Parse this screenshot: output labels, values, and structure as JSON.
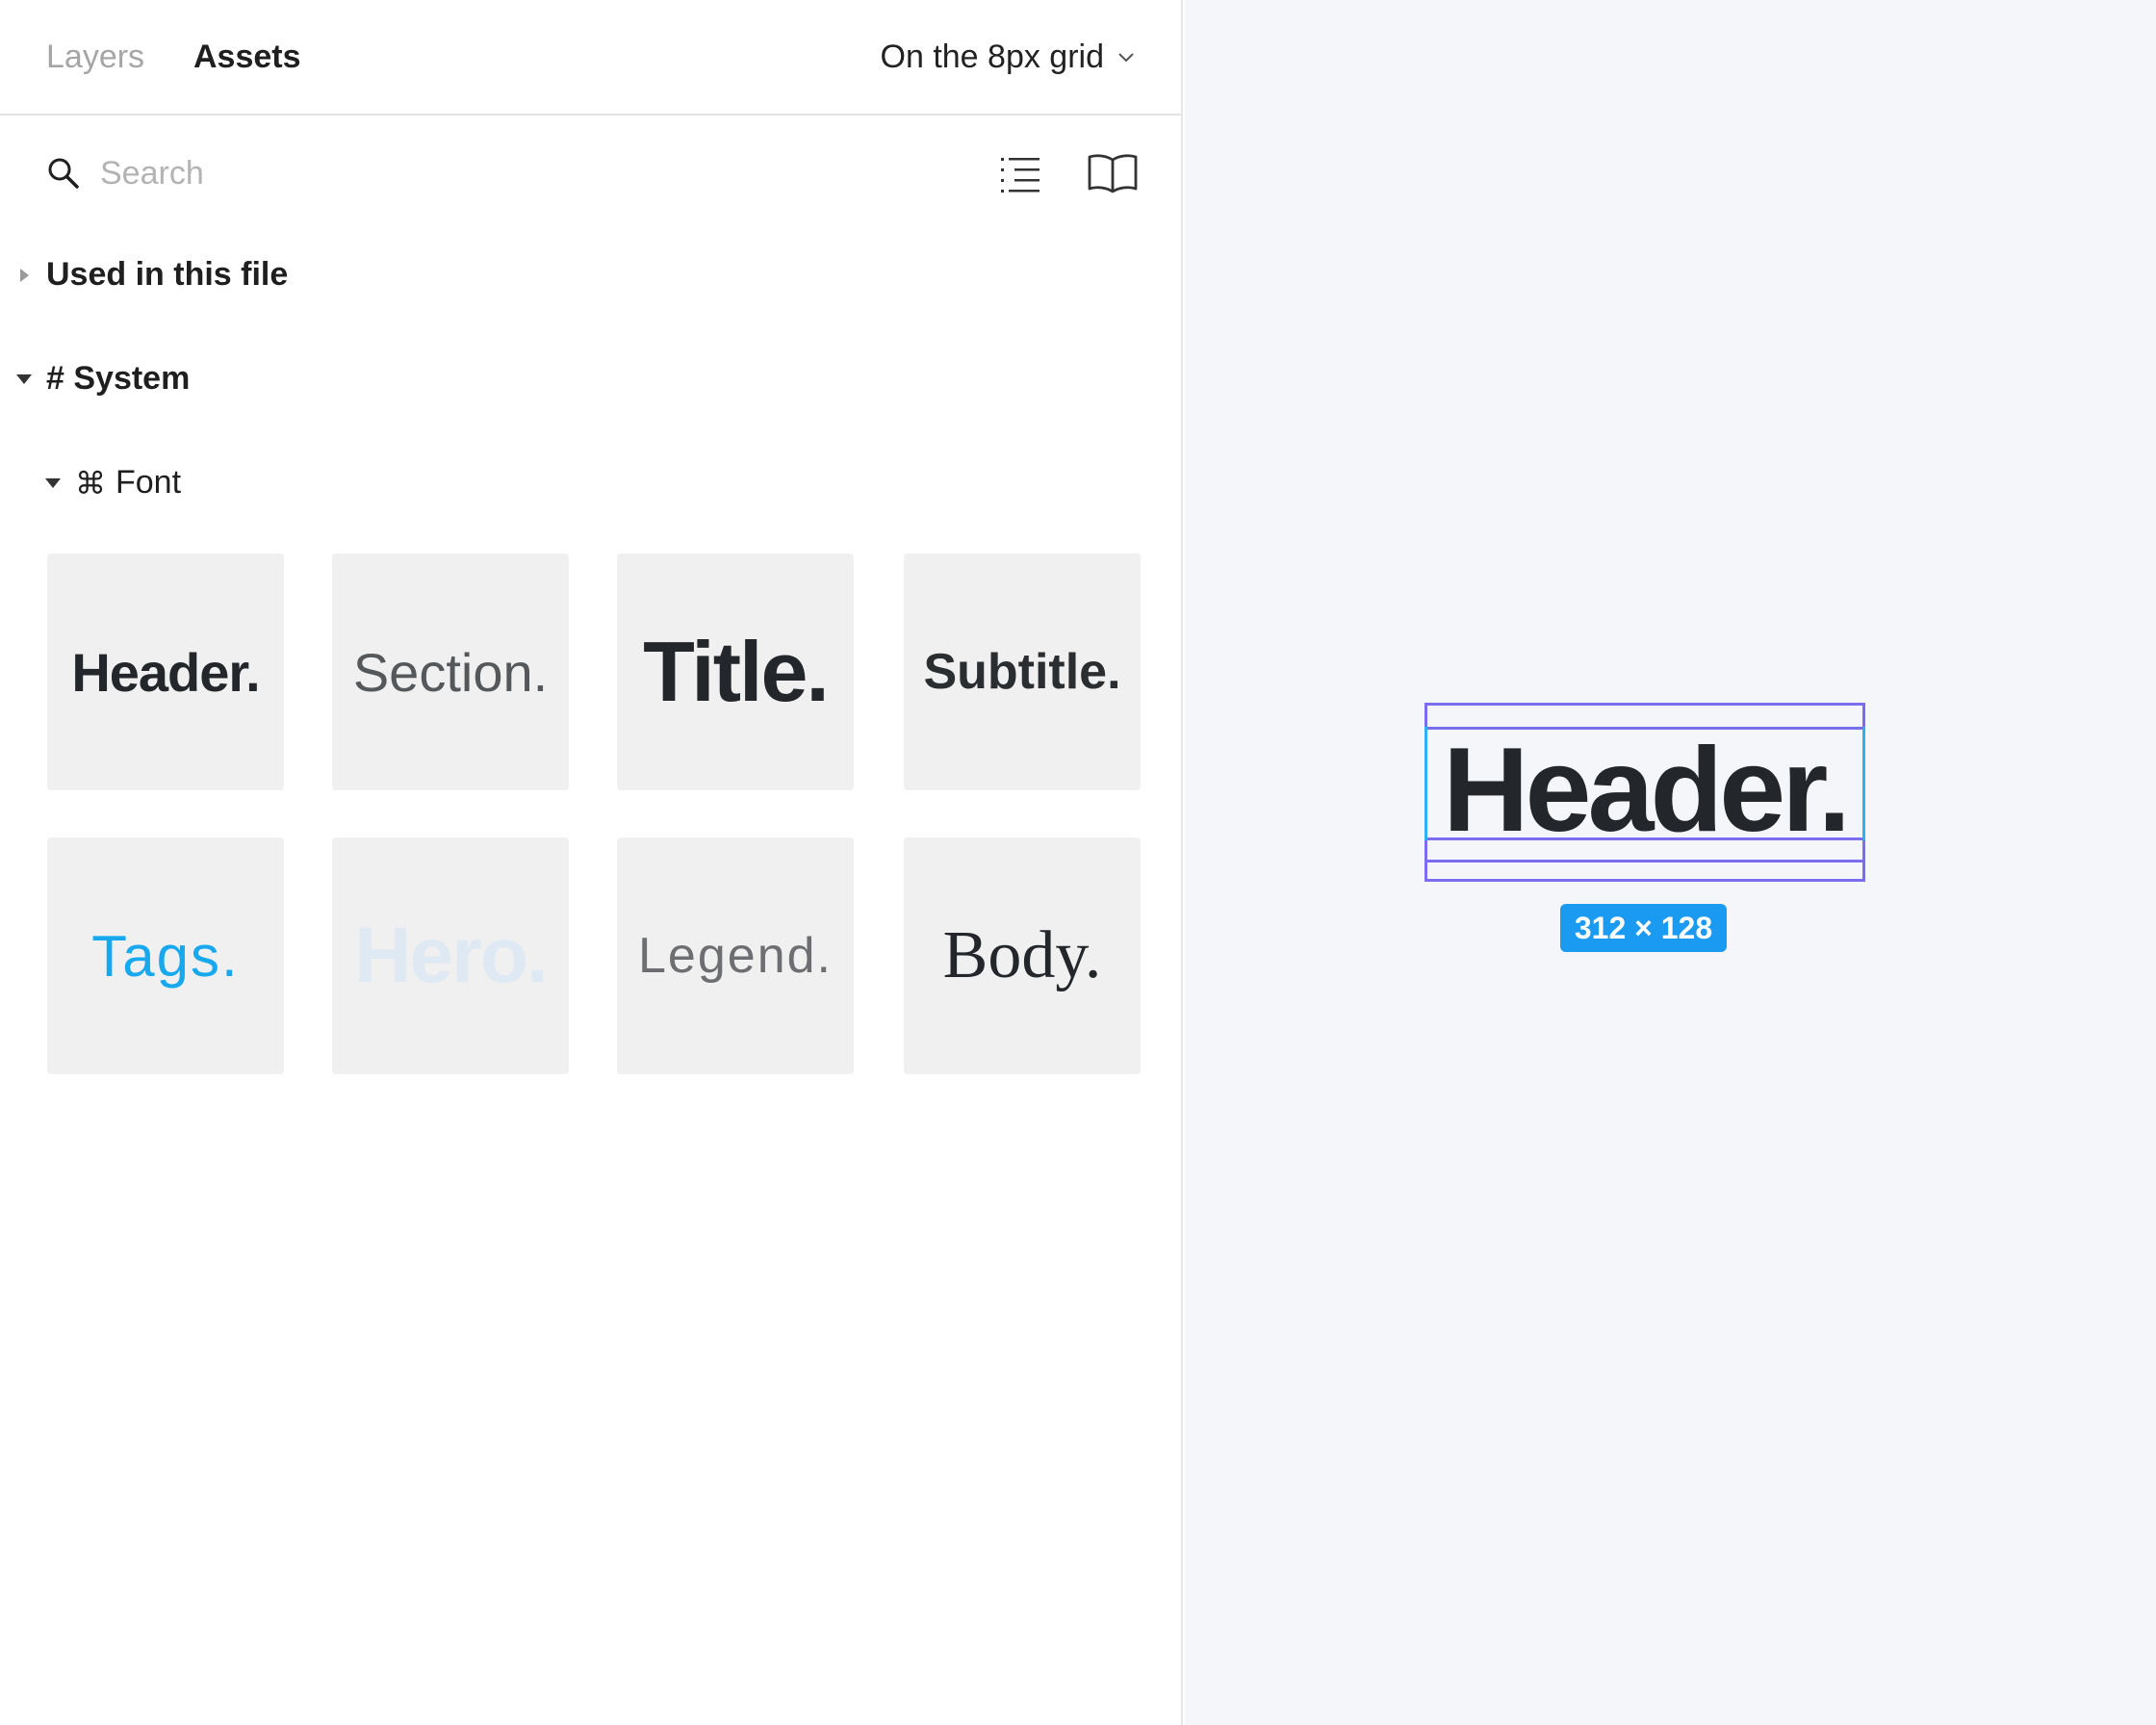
{
  "tabs": {
    "layers": "Layers",
    "assets": "Assets"
  },
  "grid_select": {
    "label": "On the 8px grid"
  },
  "search": {
    "placeholder": "Search",
    "value": ""
  },
  "sections": {
    "used_in_file": "Used in this file",
    "system": "# System",
    "font": {
      "symbol": "⌘",
      "label": "Font"
    }
  },
  "styles": [
    {
      "name": "Header.",
      "color": "#23272b"
    },
    {
      "name": "Section.",
      "color": "#55585b"
    },
    {
      "name": "Title.",
      "color": "#23272b"
    },
    {
      "name": "Subtitle.",
      "color": "#2b2e31"
    },
    {
      "name": "Tags.",
      "color": "#18a8ee"
    },
    {
      "name": "Hero.",
      "color": "#dfe9f3"
    },
    {
      "name": "Legend.",
      "color": "#6c6e71"
    },
    {
      "name": "Body.",
      "color": "#23272b"
    }
  ],
  "canvas": {
    "selected_text": "Header.",
    "dimensions": "312 × 128",
    "selection_color": "#7b6cf0",
    "badge_color": "#1a9af0"
  }
}
